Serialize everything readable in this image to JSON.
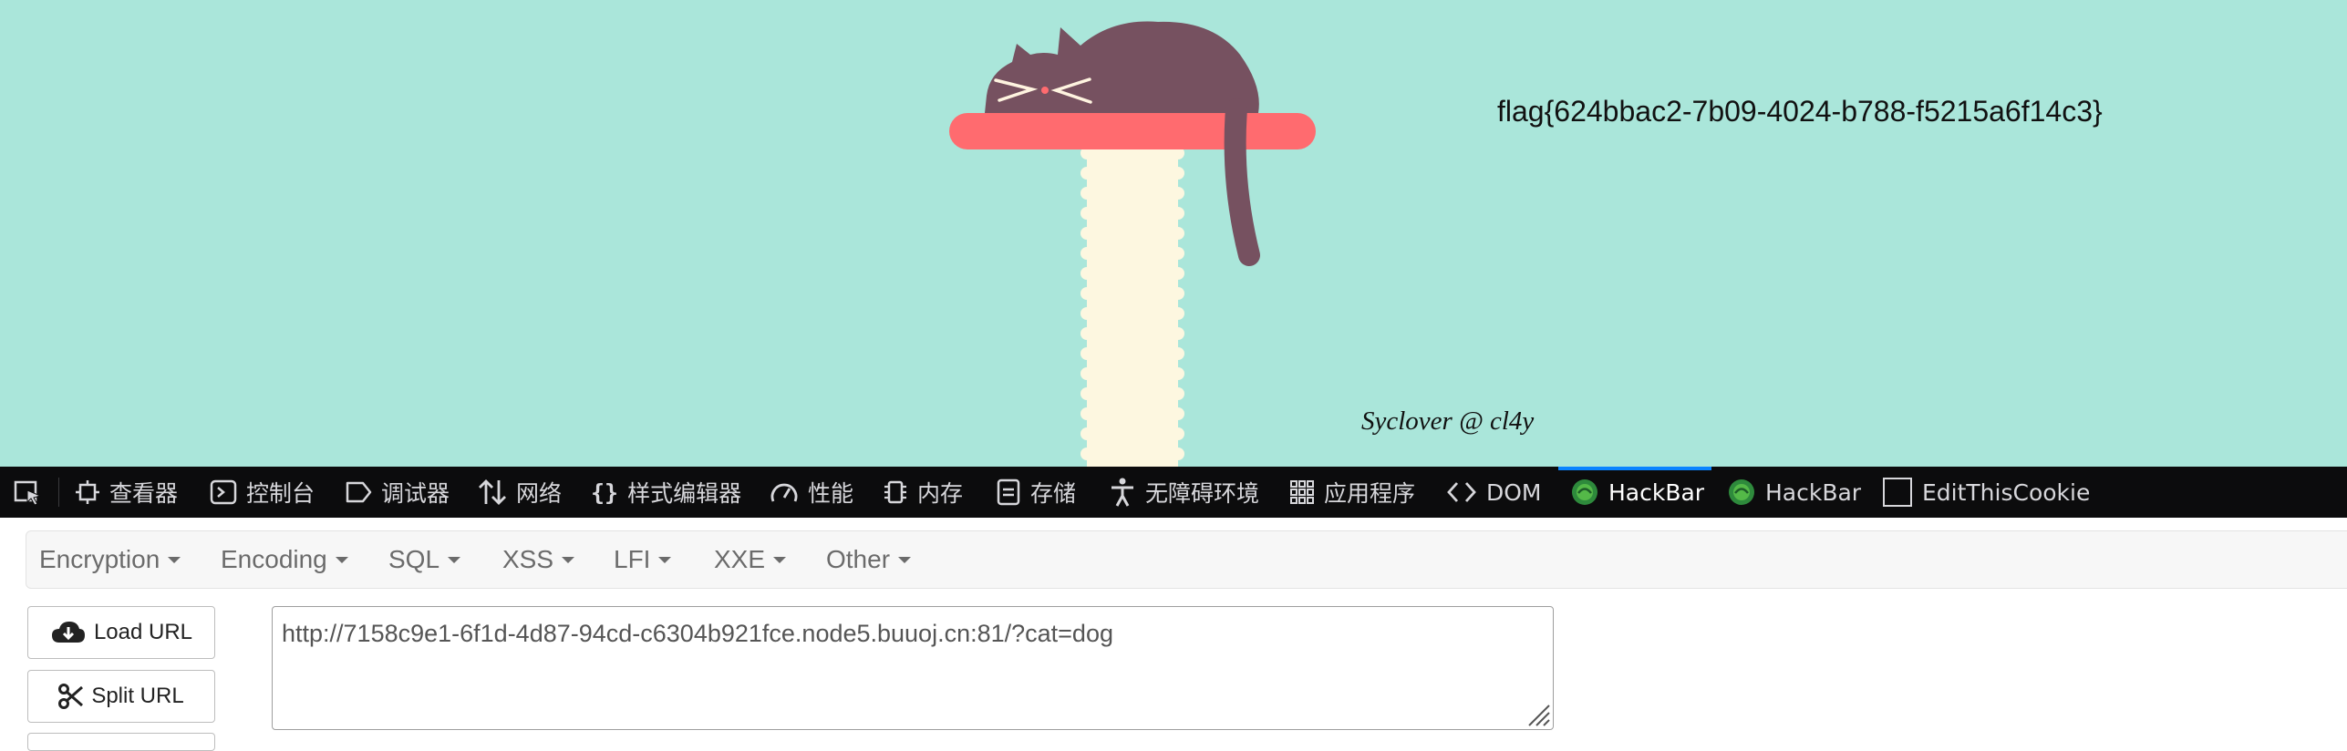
{
  "page": {
    "flag_text": "flag{624bbac2-7b09-4024-b788-f5215a6f14c3}",
    "credit": "Syclover @ cl4y"
  },
  "devtools": {
    "tabs": [
      {
        "label": "查看器",
        "icon": "inspector-icon"
      },
      {
        "label": "控制台",
        "icon": "console-icon"
      },
      {
        "label": "调试器",
        "icon": "debugger-icon"
      },
      {
        "label": "网络",
        "icon": "network-icon"
      },
      {
        "label": "样式编辑器",
        "icon": "style-editor-icon"
      },
      {
        "label": "性能",
        "icon": "performance-icon"
      },
      {
        "label": "内存",
        "icon": "memory-icon"
      },
      {
        "label": "存储",
        "icon": "storage-icon"
      },
      {
        "label": "无障碍环境",
        "icon": "accessibility-icon"
      },
      {
        "label": "应用程序",
        "icon": "application-icon"
      },
      {
        "label": "DOM",
        "icon": "dom-icon"
      },
      {
        "label": "HackBar",
        "icon": "hackbar-icon",
        "active": true
      },
      {
        "label": "HackBar",
        "icon": "hackbar-icon"
      },
      {
        "label": "EditThisCookie",
        "icon": "checkbox-icon"
      }
    ],
    "active_color": "#0a84ff"
  },
  "hackbar": {
    "menus": [
      "Encryption",
      "Encoding",
      "SQL",
      "XSS",
      "LFI",
      "XXE",
      "Other"
    ],
    "load_url_label": "Load URL",
    "split_url_label": "Split URL",
    "url_value": "http://7158c9e1-6f1d-4d87-94cd-c6304b921fce.node5.buuoj.cn:81/?cat=dog"
  },
  "colors": {
    "page_bg": "#aae6da",
    "shelf": "#ff6b6f",
    "cat": "#765160",
    "post": "#fdf7e0"
  }
}
